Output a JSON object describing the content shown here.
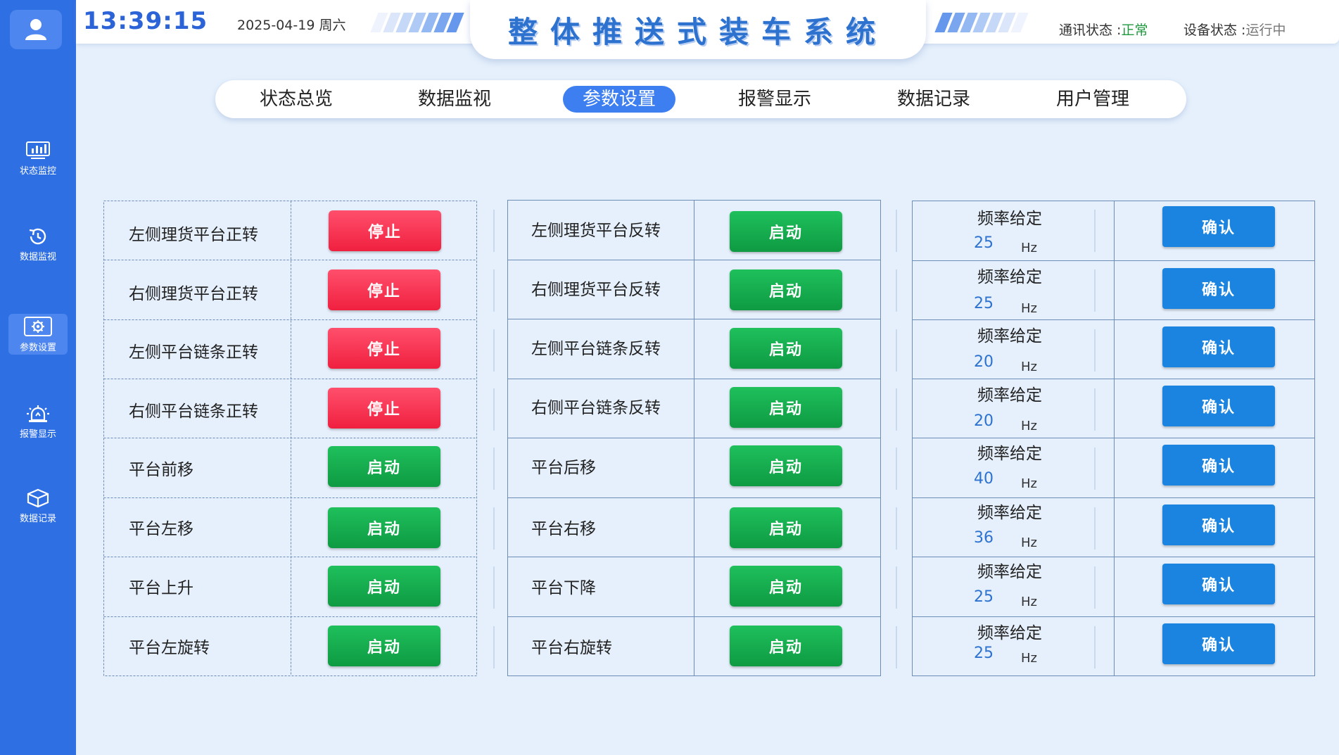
{
  "header": {
    "time": "13:39:15",
    "date": "2025-04-19 周六",
    "title": "整体推送式装车系统",
    "comm_label": "通讯状态 :",
    "comm_value": "正常",
    "device_label": "设备状态 :",
    "device_value": "运行中"
  },
  "sidebar": {
    "items": [
      {
        "label": "状态监控",
        "icon": "monitor-chart-icon"
      },
      {
        "label": "数据监视",
        "icon": "refresh-clock-icon"
      },
      {
        "label": "参数设置",
        "icon": "gear-icon"
      },
      {
        "label": "报警显示",
        "icon": "alarm-light-icon"
      },
      {
        "label": "数据记录",
        "icon": "box-icon"
      }
    ],
    "active_index": 2
  },
  "nav": {
    "tabs": [
      "状态总览",
      "数据监视",
      "参数设置",
      "报警显示",
      "数据记录",
      "用户管理"
    ],
    "active_index": 2
  },
  "left_panel": [
    {
      "label": "左侧理货平台正转",
      "button": "停止",
      "state": "running"
    },
    {
      "label": "右侧理货平台正转",
      "button": "停止",
      "state": "running"
    },
    {
      "label": "左侧平台链条正转",
      "button": "停止",
      "state": "running"
    },
    {
      "label": "右侧平台链条正转",
      "button": "停止",
      "state": "running"
    },
    {
      "label": "平台前移",
      "button": "启动",
      "state": "stopped"
    },
    {
      "label": "平台左移",
      "button": "启动",
      "state": "stopped"
    },
    {
      "label": "平台上升",
      "button": "启动",
      "state": "stopped"
    },
    {
      "label": "平台左旋转",
      "button": "启动",
      "state": "stopped"
    }
  ],
  "middle_panel": [
    {
      "label": "左侧理货平台反转",
      "button": "启动",
      "state": "stopped"
    },
    {
      "label": "右侧理货平台反转",
      "button": "启动",
      "state": "stopped"
    },
    {
      "label": "左侧平台链条反转",
      "button": "启动",
      "state": "stopped"
    },
    {
      "label": "右侧平台链条反转",
      "button": "启动",
      "state": "stopped"
    },
    {
      "label": "平台后移",
      "button": "启动",
      "state": "stopped"
    },
    {
      "label": "平台右移",
      "button": "启动",
      "state": "stopped"
    },
    {
      "label": "平台下降",
      "button": "启动",
      "state": "stopped"
    },
    {
      "label": "平台右旋转",
      "button": "启动",
      "state": "stopped"
    }
  ],
  "right_panel": [
    {
      "title": "频率给定",
      "value": "25",
      "unit": "Hz",
      "button": "确认"
    },
    {
      "title": "频率给定",
      "value": "25",
      "unit": "Hz",
      "button": "确认"
    },
    {
      "title": "频率给定",
      "value": "20",
      "unit": "Hz",
      "button": "确认"
    },
    {
      "title": "频率给定",
      "value": "20",
      "unit": "Hz",
      "button": "确认"
    },
    {
      "title": "频率给定",
      "value": "40",
      "unit": "Hz",
      "button": "确认"
    },
    {
      "title": "频率给定",
      "value": "36",
      "unit": "Hz",
      "button": "确认"
    },
    {
      "title": "频率给定",
      "value": "25",
      "unit": "Hz",
      "button": "确认"
    },
    {
      "title": "频率给定",
      "value": "25",
      "unit": "Hz",
      "button": "确认"
    }
  ],
  "colors": {
    "sidebar": "#2f6fe4",
    "accent": "#3d7ff0",
    "stop_red": "#f0203f",
    "start_green": "#0e9a42",
    "confirm_blue": "#1a84e0",
    "ok_green": "#1e9a3e"
  }
}
